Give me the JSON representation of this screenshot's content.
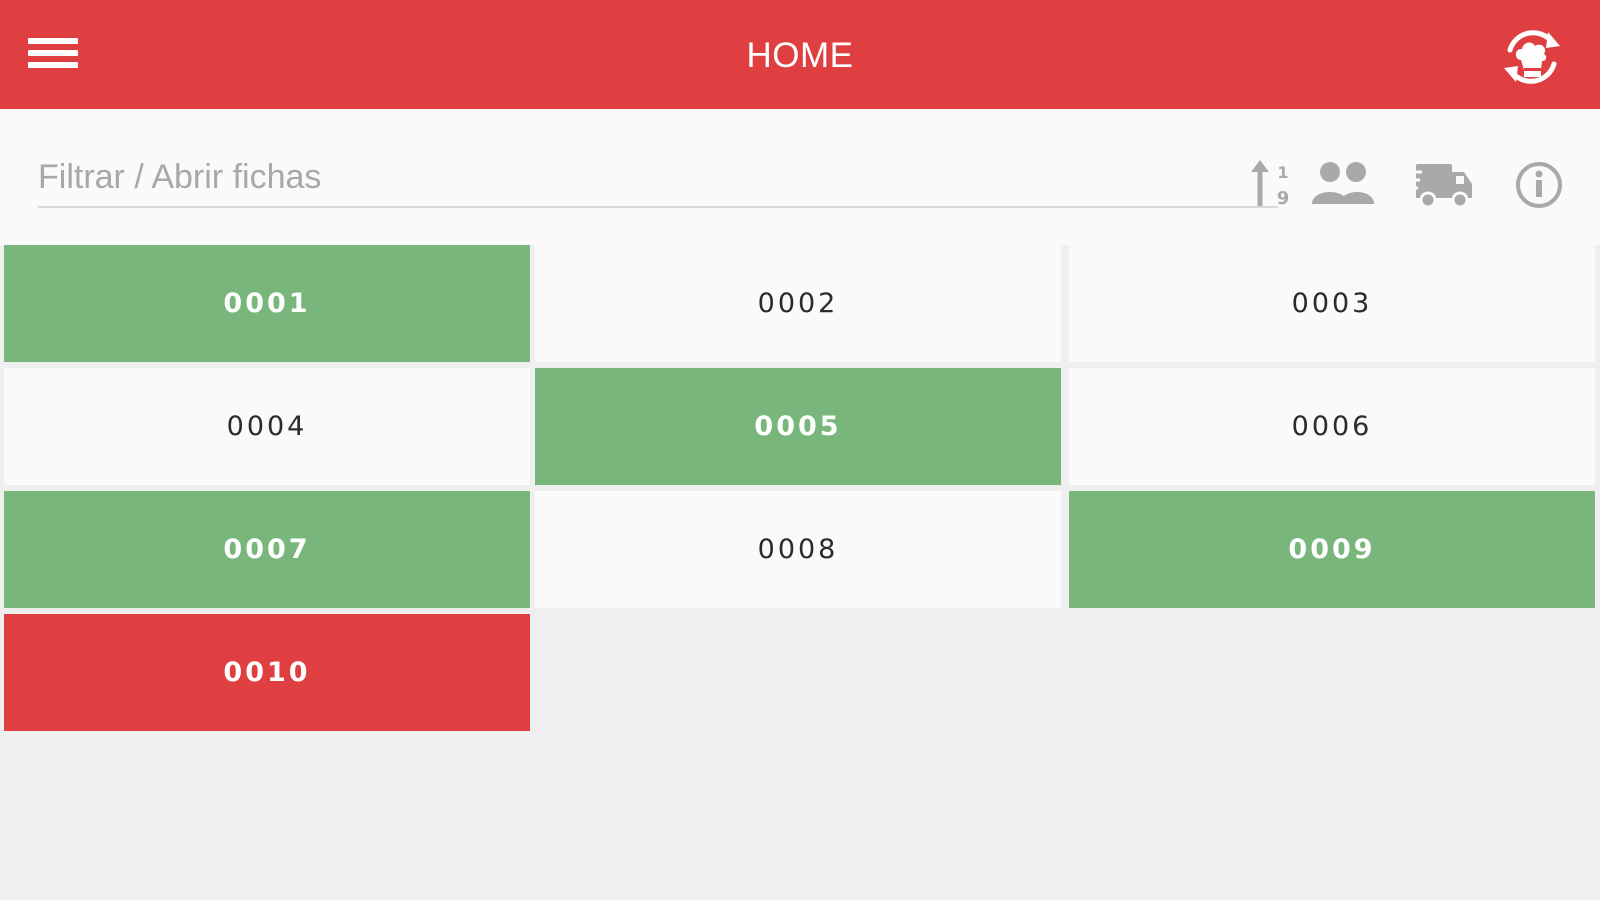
{
  "header": {
    "title": "HOME",
    "menu_icon": "hamburger-menu-icon",
    "sync_icon": "chef-sync-icon"
  },
  "filter": {
    "placeholder": "Filtrar / Abrir fichas",
    "value": ""
  },
  "toolbar": {
    "icons": [
      "sort-numeric-icon",
      "users-icon",
      "delivery-truck-icon",
      "info-icon"
    ]
  },
  "colors": {
    "accent": "#df3f40",
    "occupied": "#78b67b",
    "free": "#fafafa",
    "background": "#efefef"
  },
  "tables": [
    {
      "label": "0001",
      "status": "occupied"
    },
    {
      "label": "0002",
      "status": "free"
    },
    {
      "label": "0003",
      "status": "free"
    },
    {
      "label": "0004",
      "status": "free"
    },
    {
      "label": "0005",
      "status": "occupied"
    },
    {
      "label": "0006",
      "status": "free"
    },
    {
      "label": "0007",
      "status": "occupied"
    },
    {
      "label": "0008",
      "status": "free"
    },
    {
      "label": "0009",
      "status": "occupied"
    },
    {
      "label": "0010",
      "status": "closing"
    }
  ]
}
